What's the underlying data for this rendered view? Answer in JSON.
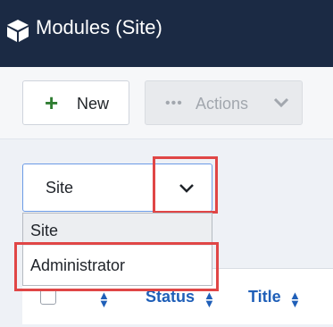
{
  "header": {
    "title": "Modules (Site)",
    "icon": "cube-icon"
  },
  "toolbar": {
    "new_label": "New",
    "new_icon": "plus-icon",
    "actions_label": "Actions",
    "actions_icon": "ellipsis-icon"
  },
  "filter": {
    "selected": "Site",
    "options": [
      "Site",
      "Administrator"
    ]
  },
  "table": {
    "columns": [
      "Status",
      "Title"
    ]
  },
  "colors": {
    "header_bg": "#1b2a44",
    "highlight": "#e04646",
    "link": "#1f5fb8",
    "new_icon": "#2f7d32"
  }
}
